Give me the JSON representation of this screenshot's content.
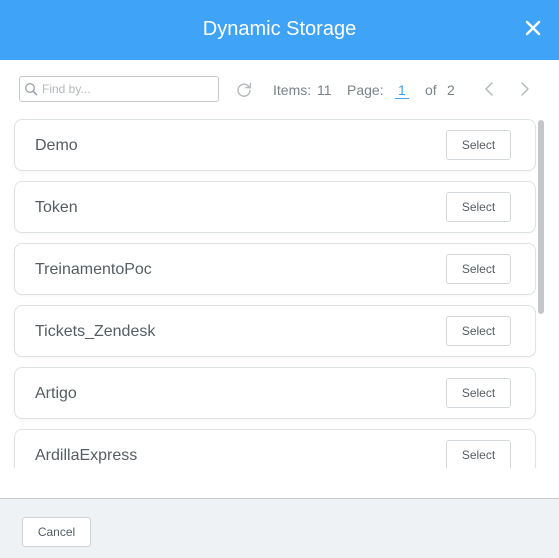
{
  "dialog": {
    "title": "Dynamic Storage"
  },
  "toolbar": {
    "search_placeholder": "Find by...",
    "items_label": "Items:",
    "items_count": "11",
    "page_label": "Page:",
    "page_current": "1",
    "page_of_label": "of",
    "page_total": "2"
  },
  "list": {
    "select_label": "Select",
    "items": [
      {
        "name": "Demo"
      },
      {
        "name": "Token"
      },
      {
        "name": "TreinamentoPoc"
      },
      {
        "name": "Tickets_Zendesk"
      },
      {
        "name": "Artigo"
      },
      {
        "name": "ArdillaExpress"
      }
    ]
  },
  "footer": {
    "cancel_label": "Cancel"
  },
  "colors": {
    "header": "#3fa3f7",
    "accent": "#3fa3f7",
    "footer": "#eff2f5",
    "text": "#555d63"
  },
  "icons": [
    "close-icon",
    "search-icon",
    "refresh-icon",
    "chevron-left-icon",
    "chevron-right-icon"
  ]
}
